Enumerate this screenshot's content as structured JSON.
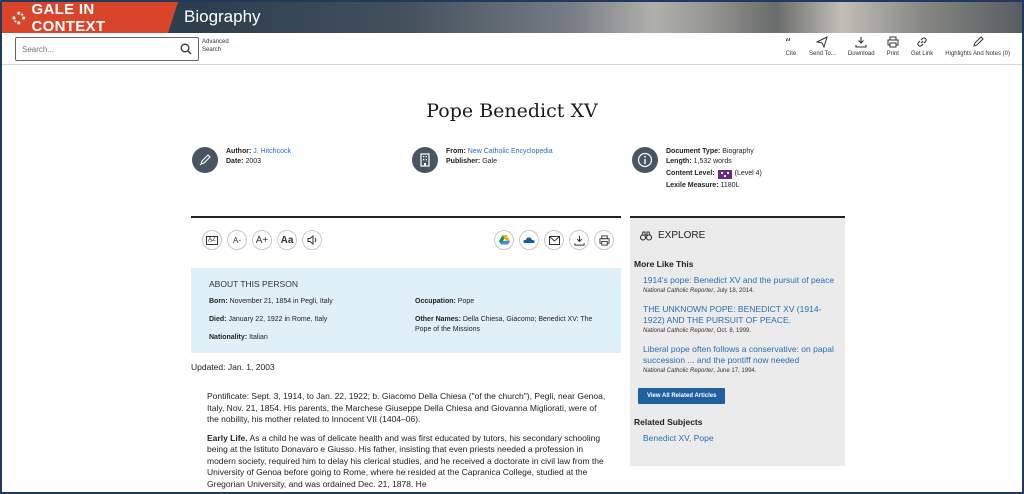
{
  "brand": {
    "name": "GALE IN CONTEXT",
    "product": "Biography"
  },
  "search": {
    "placeholder": "Search...",
    "advanced": "Advanced Search"
  },
  "tools": [
    {
      "icon": "cite-icon",
      "label": "Cite"
    },
    {
      "icon": "send-icon",
      "label": "Send To..."
    },
    {
      "icon": "download-icon",
      "label": "Download"
    },
    {
      "icon": "print-icon",
      "label": "Print"
    },
    {
      "icon": "link-icon",
      "label": "Get Link"
    },
    {
      "icon": "highlight-icon",
      "label": "Highlights And Notes (0)"
    }
  ],
  "document": {
    "title": "Pope Benedict XV",
    "author_label": "Author:",
    "author": "J. Hitchcock",
    "date_label": "Date:",
    "date": "2003",
    "from_label": "From:",
    "from": "New Catholic Encyclopedia",
    "publisher_label": "Publisher:",
    "publisher": "Gale",
    "doctype_label": "Document Type:",
    "doctype": "Biography",
    "length_label": "Length:",
    "length": "1,532 words",
    "content_label": "Content Level:",
    "content_level": "(Level 4)",
    "lexile_label": "Lexile Measure:",
    "lexile": "1180L"
  },
  "about": {
    "heading": "ABOUT THIS PERSON",
    "born_label": "Born:",
    "born": "November 21, 1854 in Pegli, Italy",
    "occupation_label": "Occupation:",
    "occupation": "Pope",
    "died_label": "Died:",
    "died": "January 22, 1922 in Rome, Italy",
    "other_label": "Other Names:",
    "other": "Della Chiesa, Giacomo; Benedict XV: The Pope of the Missions",
    "nationality_label": "Nationality:",
    "nationality": "Italian"
  },
  "updated": "Updated: Jan. 1, 2003",
  "body": {
    "p1": "Pontificate: Sept. 3, 1914, to Jan. 22, 1922; b. Giacomo Della Chiesa (\"of the church\"), Pegli, near Genoa, Italy, Nov. 21, 1854. His parents, the Marchese Giuseppe Della Chiesa and Giovanna Migliorati, were of the nobility, his mother related to Innocent VII (1404–06).",
    "p2_head": "Early Life.",
    "p2": " As a child he was of delicate health and was first educated by tutors, his secondary schooling being at the Istituto Donavaro e Giusso. His father, insisting that even priests needed a profession in modern society, required him to delay his clerical studies, and he received a doctorate in civil law from the University of Genoa before going to Rome, where he resided at the Capranica College, studied at the Gregorian University, and was ordained Dec. 21, 1878. He"
  },
  "explore": {
    "heading": "EXPLORE",
    "more_heading": "More Like This",
    "articles": [
      {
        "title": "1914's pope: Benedict XV and the pursuit of peace",
        "source": "National Catholic Reporter",
        "date": ", July 18, 2014."
      },
      {
        "title": "THE UNKNOWN POPE: BENEDICT XV (1914-1922) AND THE PURSUIT OF PEACE.",
        "source": "National Catholic Reporter",
        "date": ", Oct. 8, 1999."
      },
      {
        "title": "Liberal pope often follows a conservative: on papal succession ... and the pontiff now needed",
        "source": "National Catholic Reporter",
        "date": ", June 17, 1994."
      }
    ],
    "view_all": "View All Related Articles",
    "related_heading": "Related Subjects",
    "related": [
      "Benedict XV, Pope"
    ]
  },
  "colors": {
    "brand": "#d9452b",
    "header": "#2d3e4e",
    "link": "#2a6eb5",
    "about_bg": "#e0f0f8",
    "sidebar_bg": "#ebebeb"
  }
}
